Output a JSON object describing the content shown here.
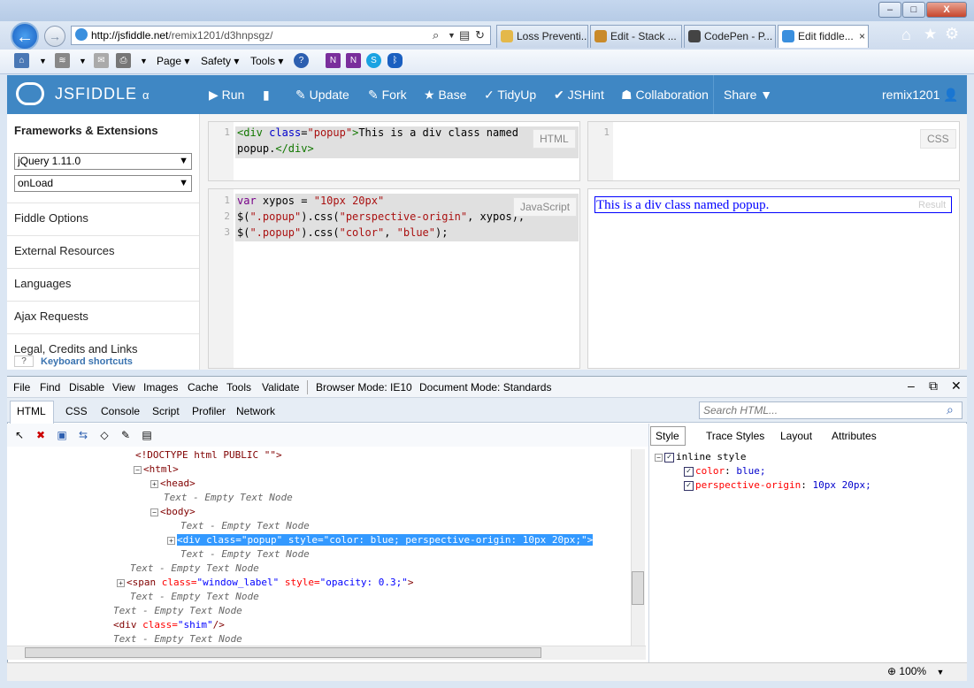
{
  "browser": {
    "address": {
      "host": "http://jsfiddle.net",
      "path": "/remix1201/d3hnpsgz/"
    },
    "tabs": [
      {
        "label": "Loss Preventi...",
        "icon": "page-icon"
      },
      {
        "label": "Edit - Stack ...",
        "icon": "edit-icon"
      },
      {
        "label": "CodePen - P...",
        "icon": "codepen-icon"
      },
      {
        "label": "Edit fiddle...",
        "icon": "jsfiddle-icon",
        "active": true
      }
    ],
    "commandbar": {
      "page": "Page",
      "safety": "Safety",
      "tools": "Tools"
    },
    "window_buttons": {
      "minimize": "–",
      "maximize": "□",
      "close": "X"
    }
  },
  "jsfiddle": {
    "brand": "JSFIDDLE",
    "brand_suffix": "α",
    "actions": {
      "run": "Run",
      "update": "Update",
      "fork": "Fork",
      "base": "Base",
      "tidyup": "TidyUp",
      "jshint": "JSHint",
      "collaboration": "Collaboration",
      "share": "Share"
    },
    "user": "remix1201",
    "sidebar": {
      "heading": "Frameworks & Extensions",
      "framework": "jQuery 1.11.0",
      "load": "onLoad",
      "items": [
        "Fiddle Options",
        "External Resources",
        "Languages",
        "Ajax Requests",
        "Legal, Credits and Links"
      ],
      "shortcut_key": "?",
      "shortcut_label": "Keyboard shortcuts"
    },
    "panels": {
      "html_label": "HTML",
      "css_label": "CSS",
      "js_label": "JavaScript",
      "result_label": "Result",
      "result_text": "This is a div class named popup.",
      "html_gutter": "1",
      "css_gutter": "1",
      "js_gutter": [
        "1",
        "2",
        "3"
      ]
    }
  },
  "devtools": {
    "menu": [
      "File",
      "Find",
      "Disable",
      "View",
      "Images",
      "Cache",
      "Tools",
      "Validate"
    ],
    "browser_mode_label": "Browser Mode:",
    "browser_mode": "IE10",
    "document_mode_label": "Document Mode:",
    "document_mode": "Standards",
    "tabs": [
      "HTML",
      "CSS",
      "Console",
      "Script",
      "Profiler",
      "Network"
    ],
    "search_placeholder": "Search HTML...",
    "style_tabs": [
      "Style",
      "Trace Styles",
      "Layout",
      "Attributes"
    ],
    "style": {
      "group": "inline style",
      "rules": [
        {
          "prop": "color",
          "value": "blue;"
        },
        {
          "prop": "perspective-origin",
          "value": "10px 20px;"
        }
      ]
    },
    "tree": {
      "doctype": "<!DOCTYPE html PUBLIC \"\">",
      "html": "<html>",
      "head": "<head>",
      "body": "<body>",
      "empty": "Text - Empty Text Node",
      "div_open": "<div ",
      "div_class_attr": "class=",
      "div_class_val": "\"popup\"",
      "div_style_attr": " style=",
      "div_style_val": "\"color: blue; perspective-origin: 10px 20px;\"",
      "div_close": ">",
      "span_open": "<span ",
      "span_class_attr": "class=",
      "span_class_val": "\"window_label\"",
      "span_style_attr": " style=",
      "span_style_val": "\"opacity: 0.3;\"",
      "span_close": ">",
      "shim_open": "<div ",
      "shim_class_attr": "class=",
      "shim_class_val": "\"shim\"",
      "shim_close": "/>"
    },
    "zoom": "100%"
  }
}
